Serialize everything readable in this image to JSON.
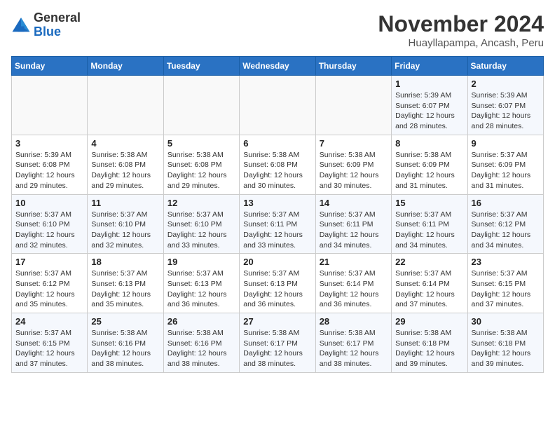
{
  "logo": {
    "general": "General",
    "blue": "Blue"
  },
  "title": "November 2024",
  "subtitle": "Huayllapampa, Ancash, Peru",
  "weekdays": [
    "Sunday",
    "Monday",
    "Tuesday",
    "Wednesday",
    "Thursday",
    "Friday",
    "Saturday"
  ],
  "weeks": [
    [
      {
        "day": "",
        "info": ""
      },
      {
        "day": "",
        "info": ""
      },
      {
        "day": "",
        "info": ""
      },
      {
        "day": "",
        "info": ""
      },
      {
        "day": "",
        "info": ""
      },
      {
        "day": "1",
        "info": "Sunrise: 5:39 AM\nSunset: 6:07 PM\nDaylight: 12 hours and 28 minutes."
      },
      {
        "day": "2",
        "info": "Sunrise: 5:39 AM\nSunset: 6:07 PM\nDaylight: 12 hours and 28 minutes."
      }
    ],
    [
      {
        "day": "3",
        "info": "Sunrise: 5:39 AM\nSunset: 6:08 PM\nDaylight: 12 hours and 29 minutes."
      },
      {
        "day": "4",
        "info": "Sunrise: 5:38 AM\nSunset: 6:08 PM\nDaylight: 12 hours and 29 minutes."
      },
      {
        "day": "5",
        "info": "Sunrise: 5:38 AM\nSunset: 6:08 PM\nDaylight: 12 hours and 29 minutes."
      },
      {
        "day": "6",
        "info": "Sunrise: 5:38 AM\nSunset: 6:08 PM\nDaylight: 12 hours and 30 minutes."
      },
      {
        "day": "7",
        "info": "Sunrise: 5:38 AM\nSunset: 6:09 PM\nDaylight: 12 hours and 30 minutes."
      },
      {
        "day": "8",
        "info": "Sunrise: 5:38 AM\nSunset: 6:09 PM\nDaylight: 12 hours and 31 minutes."
      },
      {
        "day": "9",
        "info": "Sunrise: 5:37 AM\nSunset: 6:09 PM\nDaylight: 12 hours and 31 minutes."
      }
    ],
    [
      {
        "day": "10",
        "info": "Sunrise: 5:37 AM\nSunset: 6:10 PM\nDaylight: 12 hours and 32 minutes."
      },
      {
        "day": "11",
        "info": "Sunrise: 5:37 AM\nSunset: 6:10 PM\nDaylight: 12 hours and 32 minutes."
      },
      {
        "day": "12",
        "info": "Sunrise: 5:37 AM\nSunset: 6:10 PM\nDaylight: 12 hours and 33 minutes."
      },
      {
        "day": "13",
        "info": "Sunrise: 5:37 AM\nSunset: 6:11 PM\nDaylight: 12 hours and 33 minutes."
      },
      {
        "day": "14",
        "info": "Sunrise: 5:37 AM\nSunset: 6:11 PM\nDaylight: 12 hours and 34 minutes."
      },
      {
        "day": "15",
        "info": "Sunrise: 5:37 AM\nSunset: 6:11 PM\nDaylight: 12 hours and 34 minutes."
      },
      {
        "day": "16",
        "info": "Sunrise: 5:37 AM\nSunset: 6:12 PM\nDaylight: 12 hours and 34 minutes."
      }
    ],
    [
      {
        "day": "17",
        "info": "Sunrise: 5:37 AM\nSunset: 6:12 PM\nDaylight: 12 hours and 35 minutes."
      },
      {
        "day": "18",
        "info": "Sunrise: 5:37 AM\nSunset: 6:13 PM\nDaylight: 12 hours and 35 minutes."
      },
      {
        "day": "19",
        "info": "Sunrise: 5:37 AM\nSunset: 6:13 PM\nDaylight: 12 hours and 36 minutes."
      },
      {
        "day": "20",
        "info": "Sunrise: 5:37 AM\nSunset: 6:13 PM\nDaylight: 12 hours and 36 minutes."
      },
      {
        "day": "21",
        "info": "Sunrise: 5:37 AM\nSunset: 6:14 PM\nDaylight: 12 hours and 36 minutes."
      },
      {
        "day": "22",
        "info": "Sunrise: 5:37 AM\nSunset: 6:14 PM\nDaylight: 12 hours and 37 minutes."
      },
      {
        "day": "23",
        "info": "Sunrise: 5:37 AM\nSunset: 6:15 PM\nDaylight: 12 hours and 37 minutes."
      }
    ],
    [
      {
        "day": "24",
        "info": "Sunrise: 5:37 AM\nSunset: 6:15 PM\nDaylight: 12 hours and 37 minutes."
      },
      {
        "day": "25",
        "info": "Sunrise: 5:38 AM\nSunset: 6:16 PM\nDaylight: 12 hours and 38 minutes."
      },
      {
        "day": "26",
        "info": "Sunrise: 5:38 AM\nSunset: 6:16 PM\nDaylight: 12 hours and 38 minutes."
      },
      {
        "day": "27",
        "info": "Sunrise: 5:38 AM\nSunset: 6:17 PM\nDaylight: 12 hours and 38 minutes."
      },
      {
        "day": "28",
        "info": "Sunrise: 5:38 AM\nSunset: 6:17 PM\nDaylight: 12 hours and 38 minutes."
      },
      {
        "day": "29",
        "info": "Sunrise: 5:38 AM\nSunset: 6:18 PM\nDaylight: 12 hours and 39 minutes."
      },
      {
        "day": "30",
        "info": "Sunrise: 5:38 AM\nSunset: 6:18 PM\nDaylight: 12 hours and 39 minutes."
      }
    ]
  ]
}
